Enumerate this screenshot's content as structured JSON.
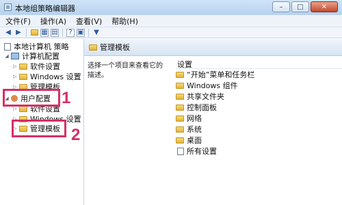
{
  "window": {
    "title": "本地组策略编辑器",
    "controls": [
      "–",
      "□",
      "✕"
    ]
  },
  "menu": [
    "文件(F)",
    "操作(A)",
    "查看(V)",
    "帮助(H)"
  ],
  "toolbar": {
    "buttons": [
      "back-arrow",
      "forward-arrow",
      "up-folder",
      "show-hide-tree",
      "export-list",
      "help",
      "properties",
      "filter"
    ]
  },
  "tree": {
    "root": "本地计算机 策略",
    "computer_config": "计算机配置",
    "cc_children": [
      "软件设置",
      "Windows 设置",
      "管理模板"
    ],
    "user_config": "用户配置",
    "uc_children": [
      "软件设置",
      "Windows 设置",
      "管理模板"
    ]
  },
  "annotations": {
    "step1": "1",
    "step2": "2",
    "color": "#d62f66"
  },
  "right": {
    "header": "管理模板",
    "description": "选择一个项目来查看它的描述。",
    "column_header": "设置",
    "items": [
      "“开始”菜单和任务栏",
      "Windows 组件",
      "共享文件夹",
      "控制面板",
      "网络",
      "系统",
      "桌面",
      "所有设置"
    ]
  }
}
